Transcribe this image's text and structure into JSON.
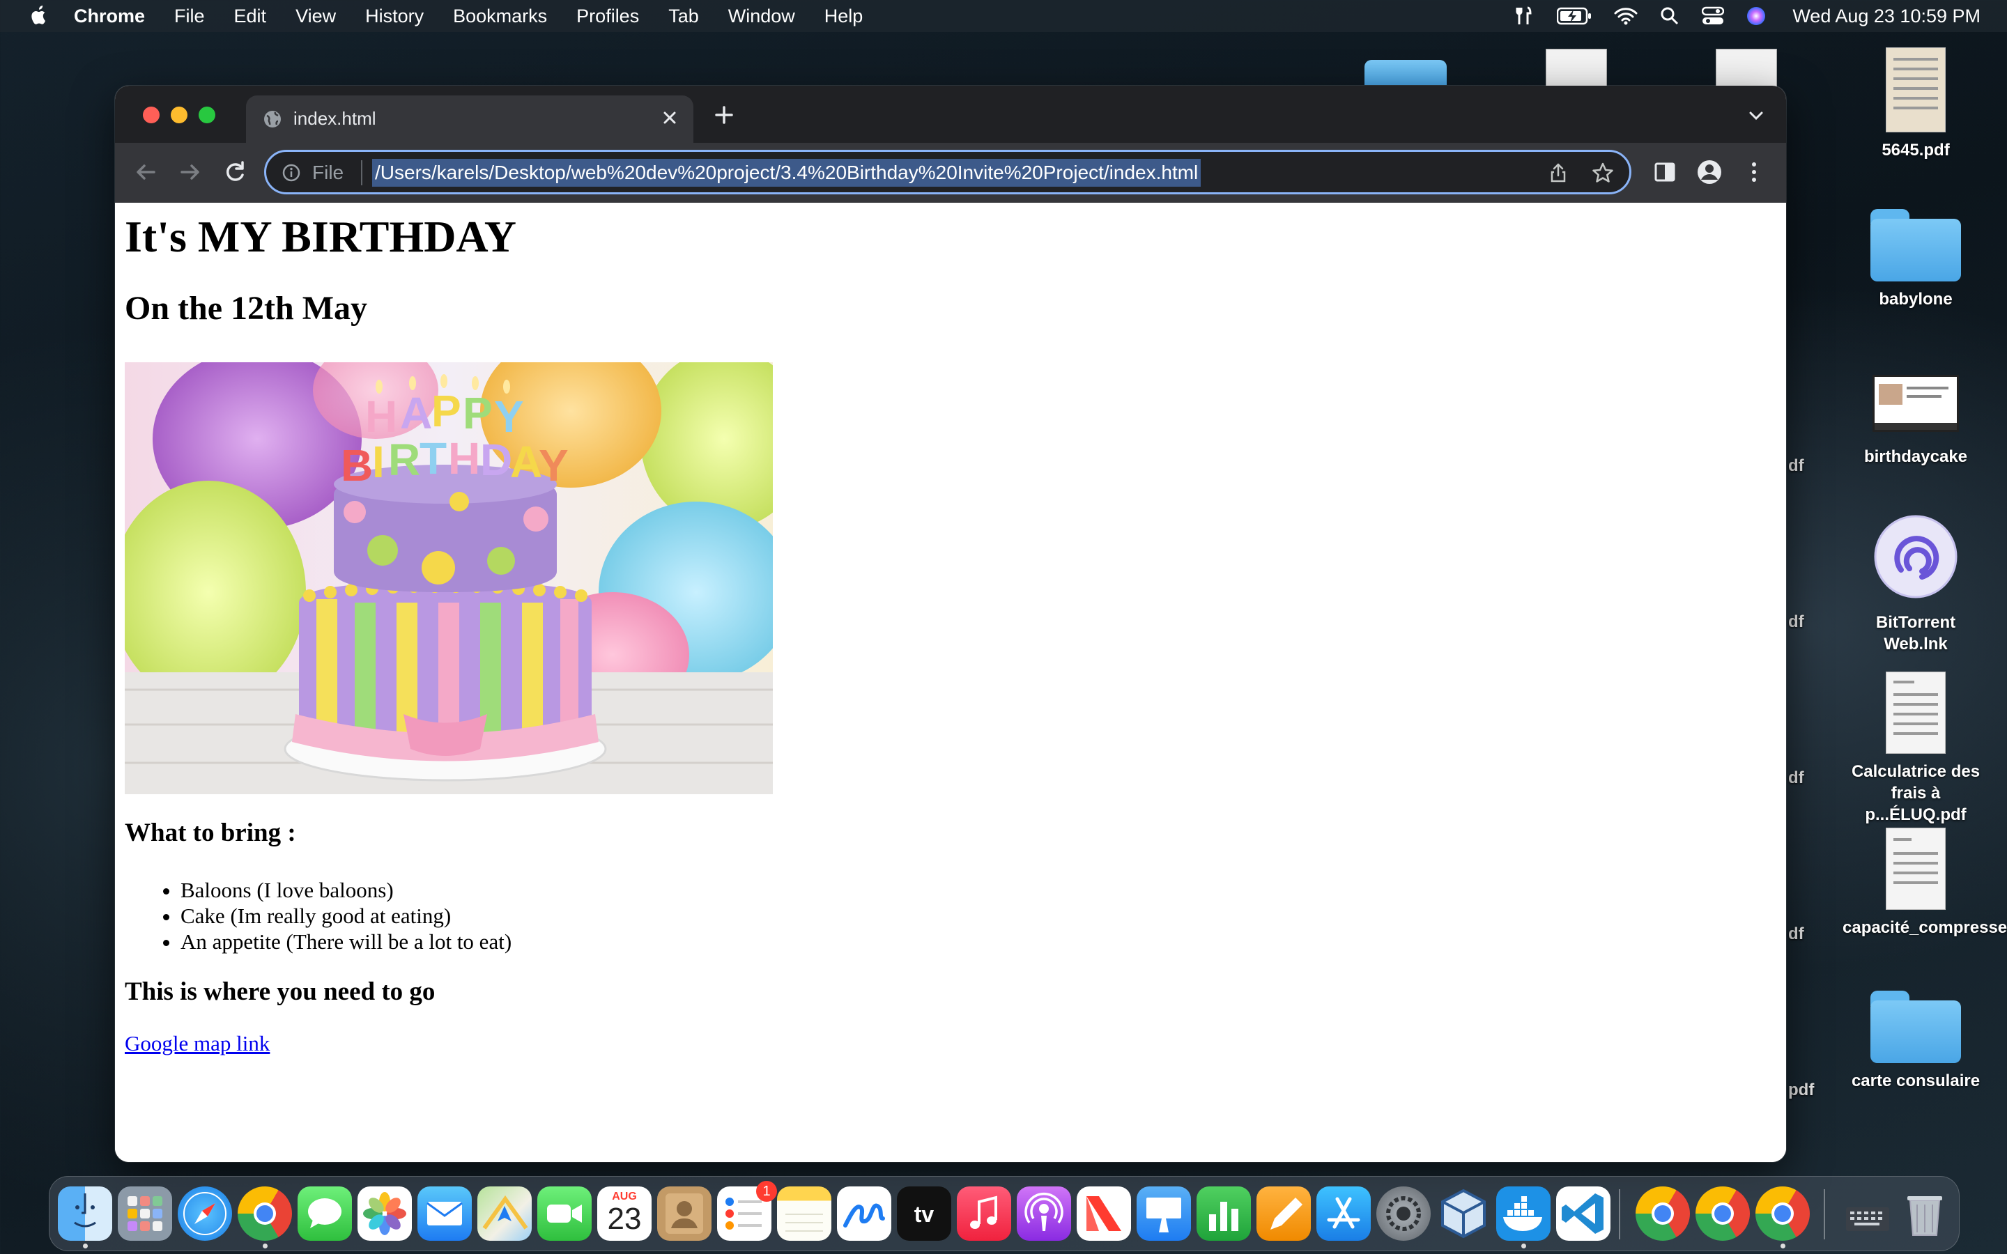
{
  "menubar": {
    "apple_icon": "apple-logo",
    "items": [
      "Chrome",
      "File",
      "Edit",
      "View",
      "History",
      "Bookmarks",
      "Profiles",
      "Tab",
      "Window",
      "Help"
    ],
    "clock": "Wed Aug 23  10:59 PM",
    "status_icons": [
      "tools-icon",
      "battery-charging-icon",
      "wifi-icon",
      "search-icon",
      "control-center-icon",
      "siri-icon"
    ]
  },
  "desktop": {
    "icons": [
      {
        "label": "5645.pdf",
        "kind": "document"
      },
      {
        "label": "babylone",
        "kind": "folder"
      },
      {
        "label": "birthdaycake",
        "kind": "screenshot"
      },
      {
        "label": "BitTorrent Web.lnk",
        "kind": "app"
      },
      {
        "label": "Calculatrice des frais à p...ÉLUQ.pdf",
        "kind": "document"
      },
      {
        "label": "capacité_compressed.pdf",
        "kind": "document"
      },
      {
        "label": "carte consulaire",
        "kind": "folder"
      }
    ],
    "partial_labels": [
      "df",
      "df",
      "df",
      "df",
      "pdf"
    ]
  },
  "browser": {
    "tab": {
      "title": "index.html",
      "icon": "globe-icon"
    },
    "omnibox": {
      "scheme": "File",
      "url": "/Users/karels/Desktop/web%20dev%20project/3.4%20Birthday%20Invite%20Project/index.html"
    }
  },
  "page": {
    "h1": "It's MY BIRTHDAY",
    "h2": "On the 12th May",
    "image_alt": "birthday cake",
    "bring_heading": "What to bring :",
    "items": [
      "Baloons (I love baloons)",
      "Cake (Im really good at eating)",
      "An appetite (There will be a lot to eat)"
    ],
    "where_heading": "This is where you need to go",
    "link": "Google map link"
  },
  "dock": {
    "apps": [
      "Finder",
      "Launchpad",
      "Safari",
      "Chrome",
      "Messages",
      "Photos",
      "Mail",
      "Maps",
      "FaceTime",
      "Calendar",
      "Contacts",
      "Reminders",
      "Notes",
      "Freeform",
      "TV",
      "Music",
      "Podcasts",
      "News",
      "Keynote",
      "Numbers",
      "Pages",
      "App Store",
      "System Settings",
      "VirtualBox",
      "Docker",
      "VS Code",
      "Chrome",
      "Chrome",
      "Chrome",
      "Downloads",
      "Trash"
    ],
    "calendar_month": "AUG",
    "calendar_day": "23",
    "tv_label": "tv",
    "reminders_badge": "1"
  },
  "colors": {
    "omnibox_focus": "#8ab4f8",
    "link": "#0000ee",
    "tabstrip": "#202124",
    "toolbar": "#35363a"
  }
}
